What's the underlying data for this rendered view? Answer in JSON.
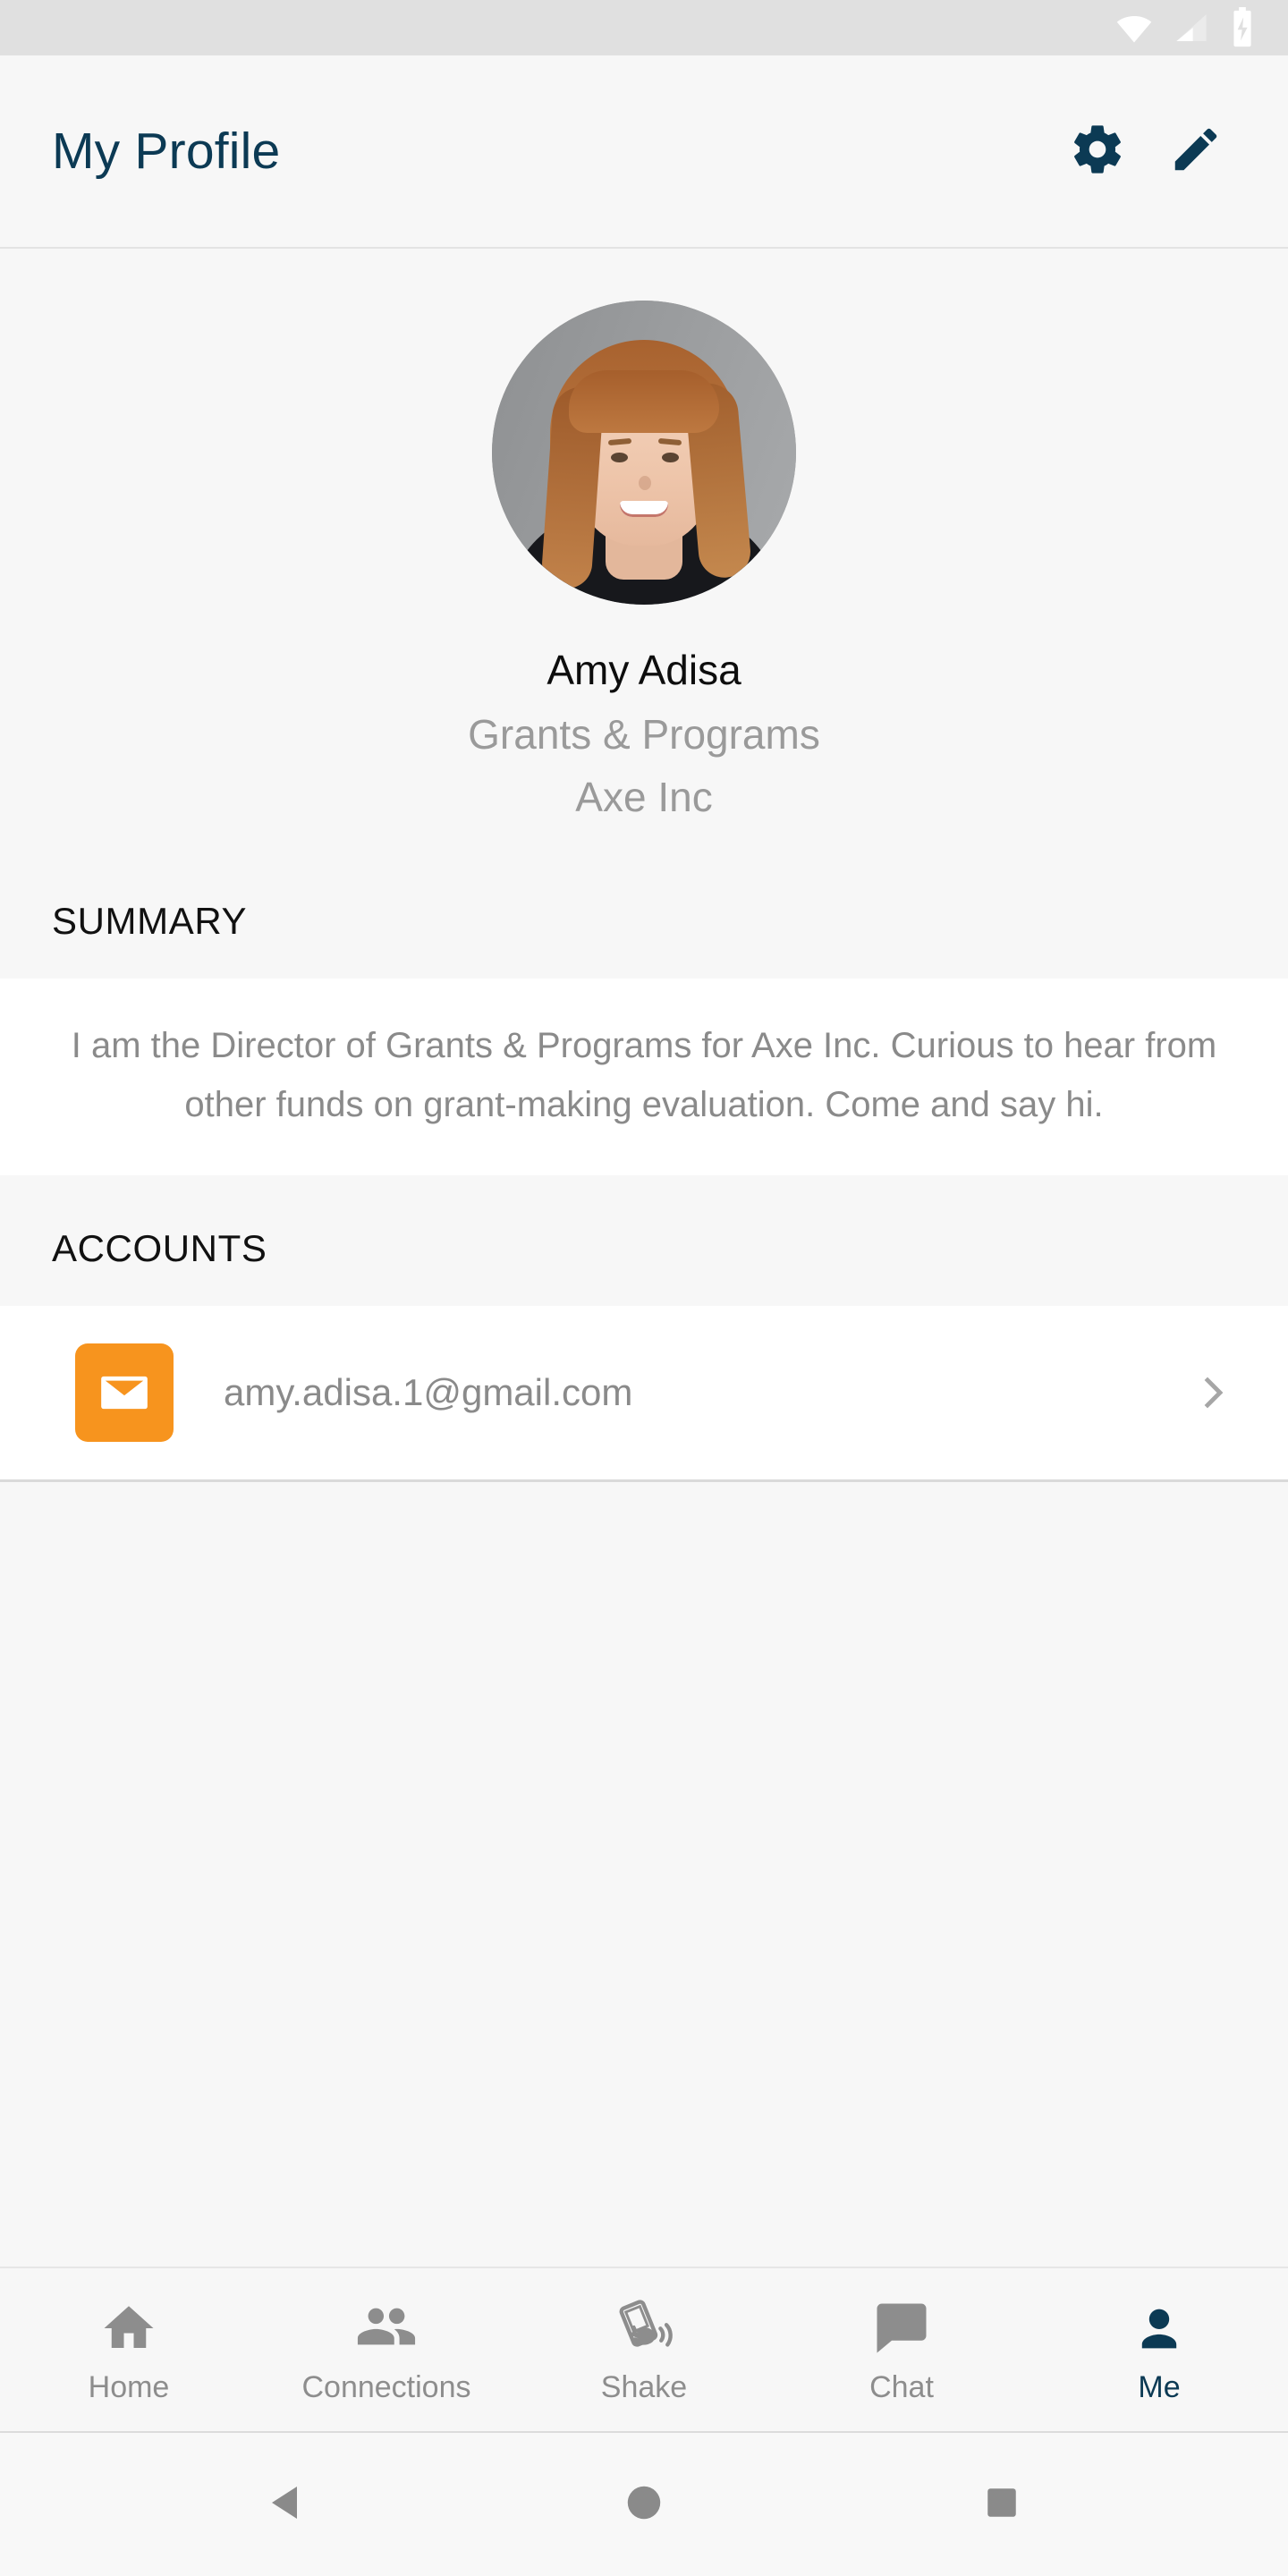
{
  "statusbar": {
    "icons": [
      "wifi-icon",
      "cellular-signal-icon",
      "battery-charging-icon"
    ],
    "background": "#e0e0e0",
    "icon_color": "#ffffff"
  },
  "appbar": {
    "title": "My Profile",
    "title_color": "#0c3a54",
    "actions": [
      {
        "name": "settings-button",
        "icon": "gear-icon"
      },
      {
        "name": "edit-button",
        "icon": "pencil-icon"
      }
    ]
  },
  "profile": {
    "avatar_alt": "profile-photo",
    "name": "Amy Adisa",
    "role": "Grants & Programs",
    "company": "Axe Inc"
  },
  "summary": {
    "header": "SUMMARY",
    "text": "I am the Director of Grants & Programs for Axe Inc. Curious to hear from other funds on grant-making evaluation. Come and say hi."
  },
  "accounts": {
    "header": "ACCOUNTS",
    "items": [
      {
        "icon": "email-icon",
        "icon_color": "#f7941e",
        "label": "amy.adisa.1@gmail.com",
        "chevron": "chevron-right-icon"
      }
    ]
  },
  "tabbar": {
    "active_color": "#0c3a54",
    "inactive_color": "#8d8d8d",
    "items": [
      {
        "label": "Home",
        "icon": "home-icon",
        "active": false
      },
      {
        "label": "Connections",
        "icon": "people-icon",
        "active": false
      },
      {
        "label": "Shake",
        "icon": "shake-phone-icon",
        "active": false
      },
      {
        "label": "Chat",
        "icon": "chat-bubble-icon",
        "active": false
      },
      {
        "label": "Me",
        "icon": "person-icon",
        "active": true
      }
    ]
  },
  "navbar": {
    "items": [
      {
        "name": "android-back-button",
        "icon": "triangle-back-icon"
      },
      {
        "name": "android-home-button",
        "icon": "circle-home-icon"
      },
      {
        "name": "android-recents-button",
        "icon": "square-recents-icon"
      }
    ]
  }
}
